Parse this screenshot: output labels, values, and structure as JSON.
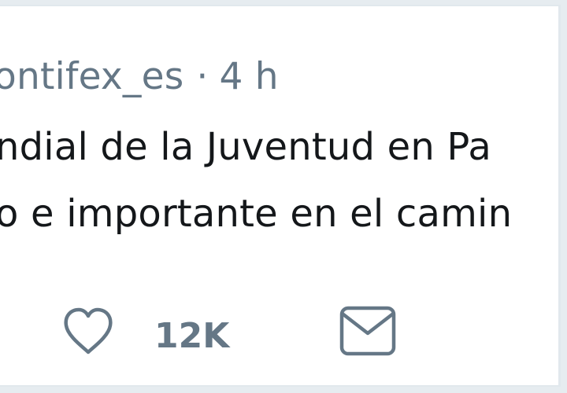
{
  "tweet": {
    "handle": "ontifex_es",
    "separator": "·",
    "time": "4 h",
    "text_line_1": "ndial de la Juventud en Pa",
    "text_line_2": "o e importante en el camin"
  },
  "actions": {
    "like_icon": "heart-icon",
    "like_count": "12K",
    "message_icon": "envelope-icon"
  },
  "colors": {
    "background": "#e6ecf0",
    "card": "#ffffff",
    "meta_text": "#657786",
    "body_text": "#14171a",
    "icon": "#657786"
  }
}
